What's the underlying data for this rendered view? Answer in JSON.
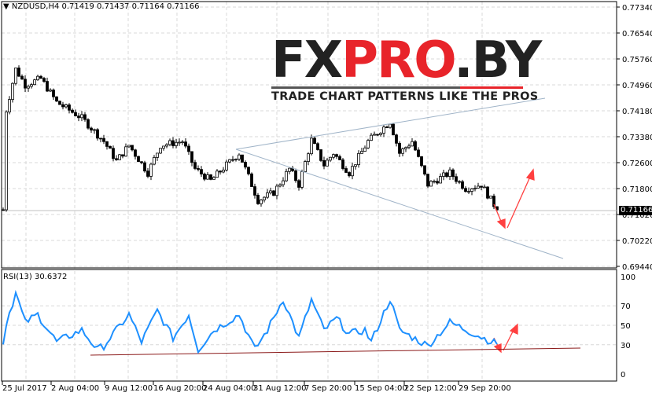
{
  "header": {
    "symbol_line": "NZDUSD,H4  0.71419 0.71437 0.71164 0.71166"
  },
  "rsi": {
    "label": "RSI(13) 30.6372",
    "ticks": [
      "100",
      "70",
      "50",
      "30",
      "0"
    ]
  },
  "price_axis": {
    "ticks": [
      "0.77340",
      "0.76540",
      "0.75760",
      "0.74960",
      "0.74180",
      "0.73380",
      "0.72600",
      "0.71800",
      "0.71020",
      "0.70220",
      "0.69440"
    ],
    "current": "0.71166"
  },
  "time_axis": {
    "ticks": [
      "25 Jul 2017",
      "2 Aug 04:00",
      "9 Aug 12:00",
      "16 Aug 20:00",
      "24 Aug 04:00",
      "31 Aug 12:00",
      "7 Sep 20:00",
      "15 Sep 04:00",
      "22 Sep 12:00",
      "29 Sep 20:00"
    ]
  },
  "logo": {
    "part1": "FX",
    "part2": "PRO",
    "part3": ".BY",
    "tagline": "TRADE CHART PATTERNS LIKE THE PROS"
  },
  "colors": {
    "candle": "#000000",
    "rsi_line": "#1e90ff",
    "arrow": "#ff4040",
    "trendline": "#a0b4c8",
    "rsi_trend": "#8b1a1a"
  },
  "chart_data": {
    "type": "candlestick",
    "price_range": [
      0.6944,
      0.7734
    ],
    "close_path": [
      [
        1,
        0.742
      ],
      [
        4,
        0.7545
      ],
      [
        7,
        0.7497
      ],
      [
        12,
        0.7516
      ],
      [
        17,
        0.7444
      ],
      [
        25,
        0.7396
      ],
      [
        32,
        0.7325
      ],
      [
        36,
        0.7265
      ],
      [
        40,
        0.7313
      ],
      [
        46,
        0.7229
      ],
      [
        50,
        0.7313
      ],
      [
        57,
        0.7325
      ],
      [
        61,
        0.7241
      ],
      [
        66,
        0.7205
      ],
      [
        71,
        0.7253
      ],
      [
        75,
        0.7289
      ],
      [
        81,
        0.7145
      ],
      [
        86,
        0.7169
      ],
      [
        91,
        0.7241
      ],
      [
        94,
        0.7193
      ],
      [
        98,
        0.7329
      ],
      [
        102,
        0.7253
      ],
      [
        105,
        0.7289
      ],
      [
        110,
        0.7229
      ],
      [
        116,
        0.7325
      ],
      [
        123,
        0.7385
      ],
      [
        126,
        0.7289
      ],
      [
        130,
        0.7325
      ],
      [
        135,
        0.7193
      ],
      [
        142,
        0.7229
      ],
      [
        147,
        0.7181
      ],
      [
        152,
        0.7193
      ],
      [
        157,
        0.71166
      ]
    ],
    "rsi_path": [
      [
        1,
        53
      ],
      [
        4,
        83
      ],
      [
        7,
        53
      ],
      [
        11,
        61
      ],
      [
        17,
        33
      ],
      [
        25,
        45
      ],
      [
        30,
        25
      ],
      [
        32,
        29
      ],
      [
        40,
        61
      ],
      [
        44,
        33
      ],
      [
        49,
        65
      ],
      [
        54,
        37
      ],
      [
        59,
        61
      ],
      [
        62,
        25
      ],
      [
        67,
        45
      ],
      [
        75,
        61
      ],
      [
        80,
        25
      ],
      [
        84,
        45
      ],
      [
        89,
        77
      ],
      [
        94,
        37
      ],
      [
        98,
        76
      ],
      [
        102,
        45
      ],
      [
        106,
        57
      ],
      [
        110,
        41
      ],
      [
        115,
        45
      ],
      [
        117,
        33
      ],
      [
        123,
        77
      ],
      [
        126,
        45
      ],
      [
        135,
        29
      ],
      [
        142,
        53
      ],
      [
        150,
        41
      ],
      [
        157,
        30.6
      ]
    ]
  }
}
